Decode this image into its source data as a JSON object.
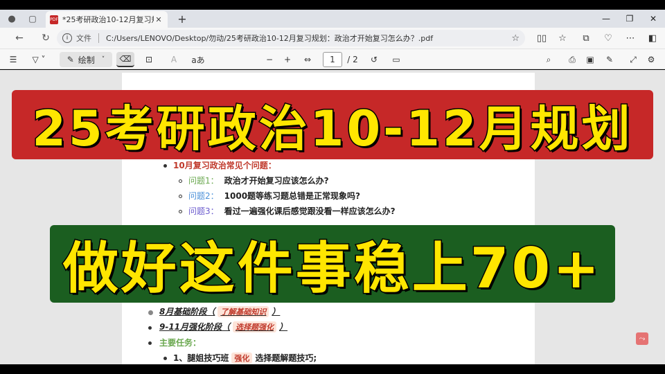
{
  "tab": {
    "title": "*25考研政治10-12月复习规划：政",
    "close": "✕",
    "new": "+"
  },
  "window": {
    "minimize": "—",
    "restore": "❐",
    "close": "✕"
  },
  "address": {
    "info": "i",
    "scheme_label": "文件",
    "url": "C:/Users/LENOVO/Desktop/勿动/25考研政治10-12月复习规划：政治才开始复习怎么办？.pdf"
  },
  "pdf_toolbar": {
    "draw_label": "绘制",
    "read_aloud": "aあ",
    "page_current": "1",
    "page_total": "/ 2"
  },
  "document": {
    "heading": "10月复习政治常见个问题：",
    "questions": [
      {
        "label": "问题1：",
        "text": "政治才开始复习应该怎么办?"
      },
      {
        "label": "问题2：",
        "text": "1000题等练习题总错是正常现象吗?"
      },
      {
        "label": "问题3：",
        "text": "看过一遍强化课后感觉跟没看一样应该怎么办?"
      }
    ],
    "stage1_label": "8月基础阶段（",
    "stage1_tag": "了解基础知识",
    "stage1_end": "）",
    "stage2_label": "9-11月强化阶段（",
    "stage2_tag": "选择题强化",
    "stage2_end": "）",
    "tasks_heading": "主要任务：",
    "task1_prefix": "1、腿姐技巧班",
    "task1_tag": "强化",
    "task1_suffix": "选择题解题技巧;"
  },
  "banners": {
    "top": "25考研政治10-12月规划",
    "bottom": "做好这件事稳上70+"
  },
  "colors": {
    "banner_top_bg": "#c62828",
    "banner_bottom_bg": "#1b5e20",
    "banner_text": "#ffe600"
  }
}
